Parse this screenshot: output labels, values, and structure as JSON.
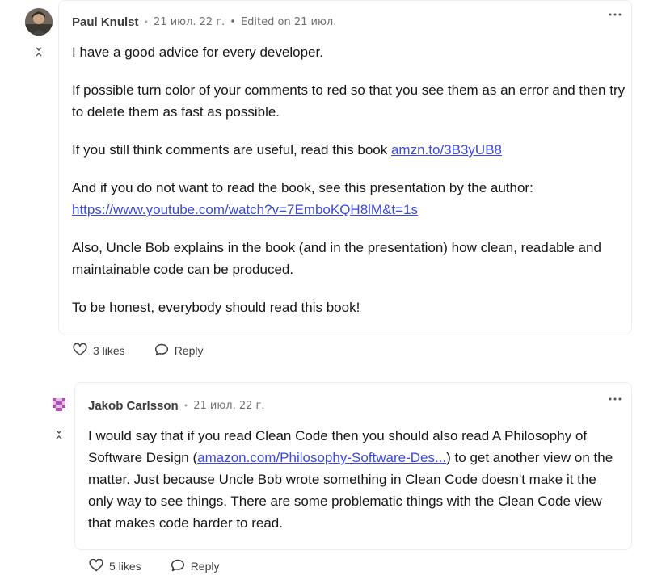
{
  "comments": [
    {
      "author": "Paul Knulst",
      "date": "21 июл. 22 г.",
      "edited": "Edited on 21 июл.",
      "paragraphs": [
        "I have a good advice for every developer.",
        "If possible turn color of your comments to red so that you see them as an error and then try to delete them as fast as possible."
      ],
      "p3_text": "If you still think comments are useful, read this book ",
      "p3_link": "amzn.to/3B3yUB8",
      "p4_text": "And if you do not want to read the book, see this presentation by the author: ",
      "p4_link": "https://www.youtube.com/watch?v=7EmboKQH8lM&t=1s",
      "p5": "Also, Uncle Bob explains in the book (and in the presentation) how clean, readable and maintainable code can be produced.",
      "p6": "To be honest, everybody should read this book!",
      "likes_label": "3 likes",
      "reply_label": "Reply"
    },
    {
      "author": "Jakob Carlsson",
      "date": "21 июл. 22 г.",
      "text_before": "I would say that if you read Clean Code then you should also read A Philosophy of Software Design (",
      "link": "amazon.com/Philosophy-Software-Des...",
      "text_after": ") to get another view on the matter. Just because Uncle Bob wrote something in Clean Code doesn't make it the only way to see things. There are some problematic things with the Clean Code view that makes code harder to read.",
      "likes_label": "5 likes",
      "reply_label": "Reply"
    }
  ],
  "icons": {
    "collapse": "collapse-arrows-icon",
    "more": "more-dots-icon",
    "like": "heart-icon",
    "reply": "comment-bubble-icon"
  },
  "colors": {
    "link": "#3b49df",
    "text": "#171717",
    "meta": "#717171",
    "border": "#ededed"
  }
}
